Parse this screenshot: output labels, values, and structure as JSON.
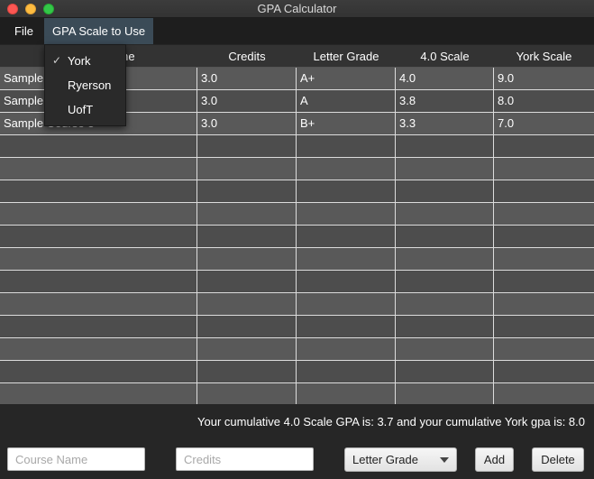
{
  "window": {
    "title": "GPA Calculator"
  },
  "menubar": {
    "file": "File",
    "scale": "GPA Scale to Use"
  },
  "scale_menu": {
    "items": [
      {
        "label": "York",
        "checked": "✓"
      },
      {
        "label": "Ryerson",
        "checked": ""
      },
      {
        "label": "UofT",
        "checked": ""
      }
    ]
  },
  "table": {
    "headers": [
      "Course Name",
      "Credits",
      "Letter Grade",
      "4.0 Scale",
      "York Scale"
    ],
    "rows": [
      [
        "Sample Course 1",
        "3.0",
        "A+",
        "4.0",
        "9.0"
      ],
      [
        "Sample Course 2",
        "3.0",
        "A",
        "3.8",
        "8.0"
      ],
      [
        "Sample Course 3",
        "3.0",
        "B+",
        "3.3",
        "7.0"
      ]
    ]
  },
  "summary": "Your cumulative 4.0 Scale GPA is: 3.7 and your cumulative York gpa is: 8.0",
  "form": {
    "course_placeholder": "Course Name",
    "credits_placeholder": "Credits",
    "grade_select": "Letter Grade",
    "add": "Add",
    "delete": "Delete"
  }
}
